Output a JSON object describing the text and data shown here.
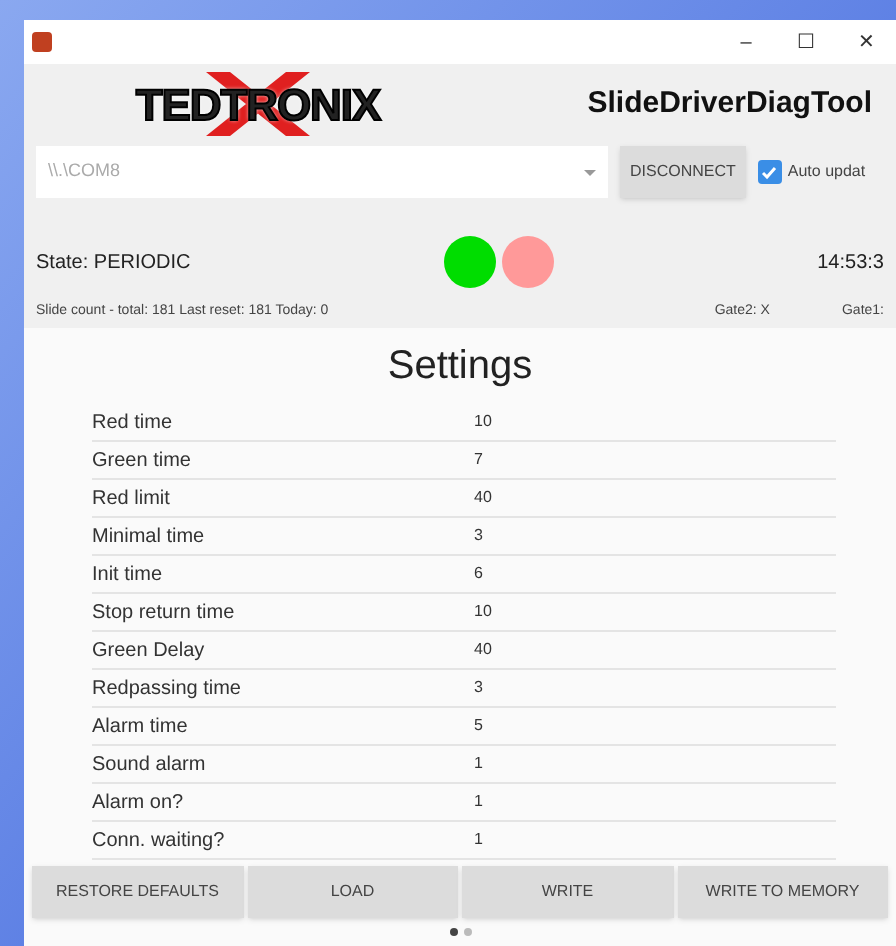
{
  "window": {
    "controls": [
      "–",
      "☐",
      "✕"
    ]
  },
  "header": {
    "logo": "TEDTRONIX",
    "title": "SlideDriverDiagTool"
  },
  "port": {
    "value": "\\\\.\\COM8",
    "button": "DISCONNECT",
    "auto_update": {
      "label": "Auto updat",
      "checked": true
    }
  },
  "status": {
    "state": "State: PERIODIC",
    "time": "14:53:3",
    "counts": "Slide count - total: 181 Last reset: 181 Today: 0",
    "gate2": "Gate2: X",
    "gate1": "Gate1:",
    "lights": [
      {
        "color": "#00dd00"
      },
      {
        "color": "#ff9999"
      }
    ]
  },
  "settings": {
    "title": "Settings",
    "rows": [
      {
        "name": "Red time",
        "value": "10"
      },
      {
        "name": "Green time",
        "value": "7"
      },
      {
        "name": "Red limit",
        "value": "40"
      },
      {
        "name": "Minimal time",
        "value": "3"
      },
      {
        "name": "Init time",
        "value": "6"
      },
      {
        "name": "Stop return time",
        "value": "10"
      },
      {
        "name": "Green Delay",
        "value": "40"
      },
      {
        "name": "Redpassing time",
        "value": "3"
      },
      {
        "name": "Alarm time",
        "value": "5"
      },
      {
        "name": "Sound alarm",
        "value": "1"
      },
      {
        "name": "Alarm on?",
        "value": "1"
      },
      {
        "name": "Conn. waiting?",
        "value": "1"
      }
    ]
  },
  "buttons": [
    "RESTORE DEFAULTS",
    "LOAD",
    "WRITE",
    "WRITE TO MEMORY"
  ],
  "pages": [
    {
      "selected": true
    },
    {
      "selected": false
    }
  ]
}
